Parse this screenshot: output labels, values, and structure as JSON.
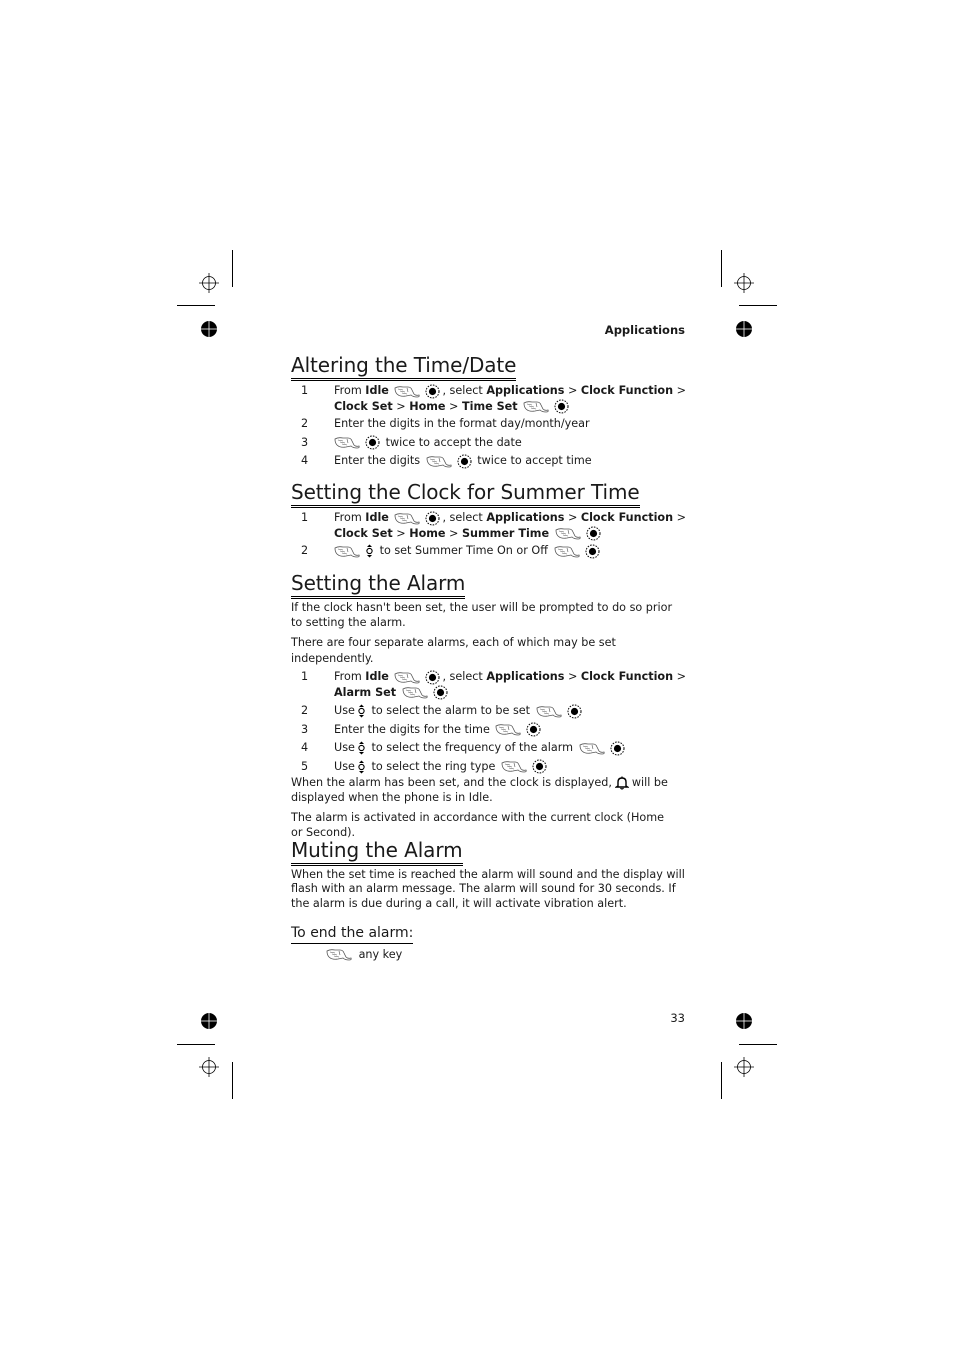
{
  "running_head": "Applications",
  "page_number": "33",
  "sections": {
    "altering": {
      "title": "Altering the Time/Date",
      "steps": [
        {
          "num": "1",
          "line1": {
            "t1": "From ",
            "b1": "Idle",
            "t2": ", select ",
            "b2": "Applications",
            "t3": " > ",
            "b3": "Clock Function",
            "t4": " >"
          },
          "line2": {
            "b1": "Clock Set",
            "t1": " > ",
            "b2": "Home",
            "t2": " > ",
            "b3": "Time Set"
          }
        },
        {
          "num": "2",
          "text": "Enter the digits in the format day/month/year"
        },
        {
          "num": "3",
          "text": "twice to accept the date"
        },
        {
          "num": "4",
          "pre": "Enter the digits",
          "text": "twice to accept time"
        }
      ]
    },
    "summer": {
      "title": "Setting the Clock for Summer Time",
      "steps": [
        {
          "num": "1",
          "line1": {
            "t1": "From ",
            "b1": "Idle",
            "t2": ", select ",
            "b2": "Applications",
            "t3": " > ",
            "b3": "Clock Function",
            "t4": " >"
          },
          "line2": {
            "b1": "Clock Set",
            "t1": " > ",
            "b2": "Home",
            "t2": " > ",
            "b3": "Summer Time"
          }
        },
        {
          "num": "2",
          "text": "to set Summer Time On or Off"
        }
      ]
    },
    "alarm": {
      "title": "Setting the Alarm",
      "intro1": "If the clock hasn't been set, the user will be prompted to do so prior to setting the alarm.",
      "intro2": "There are four separate alarms, each of which may be set independently.",
      "steps": [
        {
          "num": "1",
          "line1": {
            "t1": "From ",
            "b1": "Idle",
            "t2": ", select ",
            "b2": "Applications",
            "t3": " > ",
            "b3": "Clock Function",
            "t4": " >"
          },
          "line2": {
            "b1": "Alarm Set"
          }
        },
        {
          "num": "2",
          "pre": "Use",
          "text": "to select the alarm to be set"
        },
        {
          "num": "3",
          "text": "Enter the digits for the time"
        },
        {
          "num": "4",
          "pre": "Use",
          "text": "to select the frequency of the alarm"
        },
        {
          "num": "5",
          "pre": "Use",
          "text": "to select the ring type"
        }
      ],
      "note1_pre": "When the alarm has been set, and the clock is displayed,",
      "note1_post": "will be displayed when the phone is in Idle.",
      "note2": "The alarm is activated in accordance with the current clock (Home or Second)."
    },
    "muting": {
      "title": "Muting the Alarm",
      "body": "When the set time is reached the alarm will sound and the display will flash with an alarm message. The alarm will sound for 30 seconds. If the alarm is due during a call, it will activate vibration alert.",
      "subheading": "To end the alarm:",
      "action": "any key"
    }
  },
  "icons": {
    "press_key": "hand-press-icon",
    "select": "select-button-icon",
    "navigate": "up-down-navigation-icon",
    "alarm": "alarm-bell-icon",
    "registration": "crop-registration-mark-icon"
  }
}
